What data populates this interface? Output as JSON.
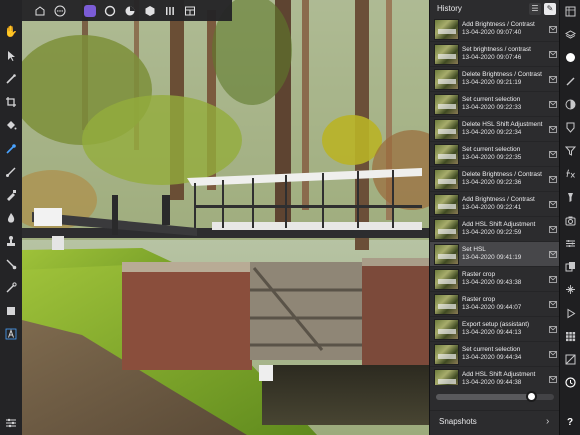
{
  "top_toolbar": {
    "items": [
      {
        "name": "back-icon"
      },
      {
        "name": "document-icon"
      },
      {
        "name": "more-icon"
      },
      {
        "name": "photo-persona-icon",
        "active": true
      },
      {
        "name": "liquify-persona-icon"
      },
      {
        "name": "develop-persona-icon"
      },
      {
        "name": "tone-mapping-persona-icon"
      },
      {
        "name": "export-persona-icon"
      },
      {
        "name": "grid-view-icon"
      }
    ],
    "accent": "#7b5cd6"
  },
  "left_toolbar": {
    "tools": [
      "view-hand-tool-icon",
      "move-tool-icon",
      "selection-brush-icon",
      "crop-tool-icon",
      "flood-fill-icon",
      "color-picker-icon",
      "paint-brush-icon",
      "clone-tool-icon",
      "burn-tool-icon",
      "stamp-tool-icon",
      "dodge-tool-icon",
      "retouch-tool-icon",
      "shape-tool-icon",
      "text-tool-icon"
    ],
    "active_index": 5,
    "bottom_tool": "settings-sliders-icon"
  },
  "history": {
    "title": "History",
    "entries": [
      {
        "label": "Add Brightness / Contrast",
        "time": "13-04-2020 09:07:40"
      },
      {
        "label": "Set brightness / contrast",
        "time": "13-04-2020 09:07:46"
      },
      {
        "label": "Delete Brightness / Contrast",
        "time": "13-04-2020 09:21:19"
      },
      {
        "label": "Set current selection",
        "time": "13-04-2020 09:22:33"
      },
      {
        "label": "Delete HSL Shift Adjustment",
        "time": "13-04-2020 09:22:34"
      },
      {
        "label": "Set current selection",
        "time": "13-04-2020 09:22:35"
      },
      {
        "label": "Delete Brightness / Contrast",
        "time": "13-04-2020 09:22:36"
      },
      {
        "label": "Add Brightness / Contrast",
        "time": "13-04-2020 09:22:41"
      },
      {
        "label": "Add HSL Shift Adjustment",
        "time": "13-04-2020 09:22:59"
      },
      {
        "label": "Set HSL",
        "time": "13-04-2020 09:41:19",
        "selected": true
      },
      {
        "label": "Raster crop",
        "time": "13-04-2020 09:43:38"
      },
      {
        "label": "Raster crop",
        "time": "13-04-2020 09:44:07"
      },
      {
        "label": "Export setup (assistant)",
        "time": "13-04-2020 09:44:13"
      },
      {
        "label": "Set current selection",
        "time": "13-04-2020 09:44:34"
      },
      {
        "label": "Add HSL Shift Adjustment",
        "time": "13-04-2020 09:44:38"
      }
    ],
    "slider_position": 0.81,
    "snapshots_label": "Snapshots"
  },
  "right_toolbar": {
    "tools": [
      "history-icon",
      "layers-icon",
      "color-icon",
      "brushes-icon",
      "adjustments-icon",
      "effects-icon",
      "styles-icon",
      "fx-icon",
      "filters-icon",
      "channels-icon",
      "navigator-icon",
      "transform-icon",
      "stock-icon",
      "macro-icon",
      "swatches-icon",
      "histogram-icon",
      "snapshots-icon"
    ],
    "active_index": 16,
    "help_label": "?"
  }
}
